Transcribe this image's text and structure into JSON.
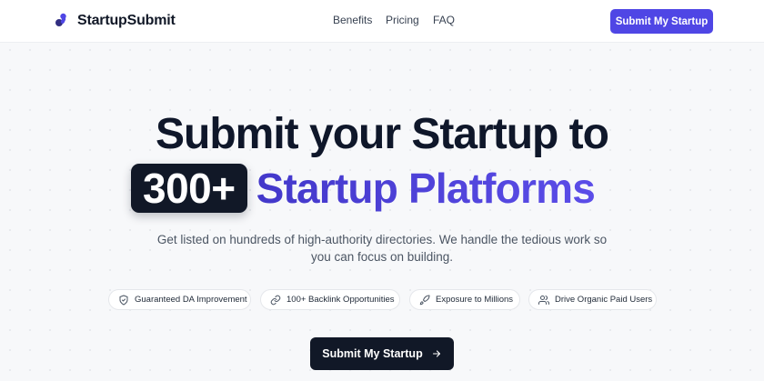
{
  "nav": {
    "brand": "StartupSubmit",
    "links": [
      "Benefits",
      "Pricing",
      "FAQ"
    ],
    "cta_label": "Submit My Startup"
  },
  "hero": {
    "title_line1": "Submit your Startup to",
    "badge": "300+",
    "title_accent": "Startup Platforms",
    "subtitle": "Get listed on hundreds of high-authority directories. We handle the tedious work so you can focus on building."
  },
  "features": [
    {
      "label": "Guaranteed DA Improvement",
      "icon": "shield-icon"
    },
    {
      "label": "100+ Backlink Opportunities",
      "icon": "link-icon"
    },
    {
      "label": "Exposure to Millions",
      "icon": "rocket-icon"
    },
    {
      "label": "Drive Organic Paid Users",
      "icon": "users-icon"
    }
  ],
  "cta": {
    "label": "Submit My Startup",
    "icon": "arrow-right-icon"
  },
  "colors": {
    "accent": "#4f46e5",
    "dark": "#111827",
    "background": "#f7f8fa"
  }
}
